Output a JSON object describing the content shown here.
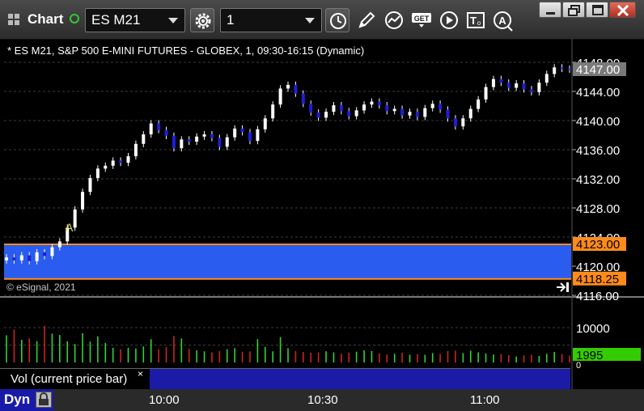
{
  "window": {
    "title": "Chart"
  },
  "toolbar": {
    "symbol": "ES M21",
    "interval": "1"
  },
  "chart": {
    "header": "* ES M21, S&P 500 E-MINI FUTURES - GLOBEX, 1, 09:30-16:15 (Dynamic)",
    "copyright": "© eSignal, 2021",
    "annotation_label": "A",
    "last_price_label": "4147.00",
    "band_top_label": "4123.00",
    "band_bottom_label": "4118.25",
    "volume_label": "Vol (current price bar)",
    "volume_close_label": "×",
    "current_volume_label": "1995",
    "volume_tick_label": "10000",
    "volume_tick_zero": "0",
    "dyn_label": "Dyn",
    "colors": {
      "up": "#ffffff",
      "down": "#1f1fd6",
      "band": "#2a5cf0",
      "band_line": "#ff8c1a",
      "vol_up": "#32d232",
      "vol_down": "#cc2222",
      "current_volume": "#33cc00"
    }
  },
  "chart_data": {
    "type": "candlestick",
    "y_axis_ticks": [
      "4148.00",
      "4144.00",
      "4140.00",
      "4136.00",
      "4132.00",
      "4128.00",
      "4124.00",
      "4120.00",
      "4116.00"
    ],
    "ylim": [
      4115,
      4149.5
    ],
    "x_ticks": [
      "10:00",
      "10:30",
      "11:00"
    ],
    "y2_ticks": [
      "10000",
      "0"
    ],
    "series": [
      {
        "name": "Price",
        "values": [
          4121.2,
          4120.8,
          4121.5,
          4120.7,
          4121.9,
          4121.4,
          4122.6,
          4123.4,
          4125.3,
          4127.8,
          4130.2,
          4132.1,
          4133.4,
          4133.8,
          4134.5,
          4134.2,
          4135.1,
          4136.8,
          4138.1,
          4139.6,
          4138.7,
          4137.9,
          4136.2,
          4137.4,
          4137.1,
          4137.8,
          4138.1,
          4137.6,
          4136.4,
          4137.7,
          4138.9,
          4138.4,
          4137.2,
          4138.8,
          4140.3,
          4142.2,
          4144.4,
          4144.9,
          4143.7,
          4142.3,
          4141.1,
          4140.4,
          4141.2,
          4142.1,
          4141.3,
          4140.6,
          4141.4,
          4142.2,
          4142.6,
          4142.1,
          4141.3,
          4141.6,
          4140.7,
          4141.2,
          4140.5,
          4141.7,
          4142.3,
          4141.5,
          4140.3,
          4139.2,
          4140.3,
          4141.6,
          4142.9,
          4144.6,
          4145.7,
          4145.2,
          4144.5,
          4145.1,
          4144.3,
          4143.9,
          4145.2,
          4146.4,
          4147.3,
          4147.1,
          4147.0
        ]
      },
      {
        "name": "Volume",
        "values": [
          7800,
          9500,
          6500,
          6900,
          6100,
          10500,
          8300,
          7900,
          6100,
          5300,
          8400,
          6000,
          7500,
          5600,
          4200,
          3800,
          4200,
          4000,
          4600,
          6700,
          3800,
          4400,
          7600,
          6900,
          3900,
          3500,
          3200,
          2900,
          3300,
          3800,
          4100,
          3100,
          3200,
          6700,
          4500,
          3200,
          7300,
          4100,
          3300,
          3000,
          2800,
          2900,
          3200,
          2900,
          2500,
          2800,
          3100,
          3500,
          3300,
          2600,
          2300,
          2500,
          2800,
          2200,
          2400,
          2200,
          2700,
          2500,
          3300,
          3400,
          2700,
          3400,
          2900,
          2600,
          2300,
          2400,
          2100,
          1700,
          2000,
          2200,
          1900,
          2500,
          3000,
          2400,
          1995
        ]
      }
    ]
  }
}
